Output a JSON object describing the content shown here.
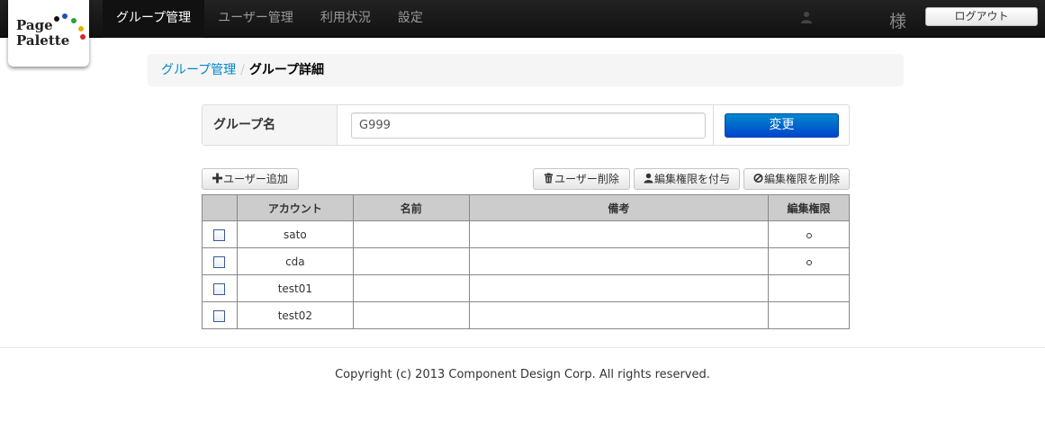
{
  "logo": {
    "line1": "Page",
    "line2": "Palette"
  },
  "nav": {
    "items": [
      "グループ管理",
      "ユーザー管理",
      "利用状況",
      "設定"
    ],
    "user_suffix": "様",
    "logout_label": "ログアウト"
  },
  "breadcrumb": {
    "parent": "グループ管理",
    "separator": "/",
    "current": "グループ詳細"
  },
  "group_form": {
    "label": "グループ名",
    "value": "G999",
    "change_label": "変更"
  },
  "actions": {
    "add_user": "ユーザー追加",
    "delete_user": "ユーザー削除",
    "grant_edit": "編集権限を付与",
    "revoke_edit": "編集権限を削除"
  },
  "table": {
    "headers": [
      "",
      "アカウント",
      "名前",
      "備考",
      "編集権限"
    ],
    "rows": [
      {
        "account": "sato",
        "name": "",
        "note": "",
        "edit": true
      },
      {
        "account": "cda",
        "name": "",
        "note": "",
        "edit": true
      },
      {
        "account": "test01",
        "name": "",
        "note": "",
        "edit": false
      },
      {
        "account": "test02",
        "name": "",
        "note": "",
        "edit": false
      }
    ]
  },
  "footer": {
    "copyright": "Copyright (c) 2013 Component Design Corp. All rights reserved."
  },
  "colors": {
    "navbar": "#1b1b1b",
    "link": "#0088cc",
    "primary": "#0055cc",
    "table_header": "#cccccc"
  },
  "icons": [
    "user-icon",
    "plus-icon",
    "trash-icon",
    "user-grant-icon",
    "ban-icon",
    "checkbox-icon",
    "circle-mark-icon"
  ]
}
